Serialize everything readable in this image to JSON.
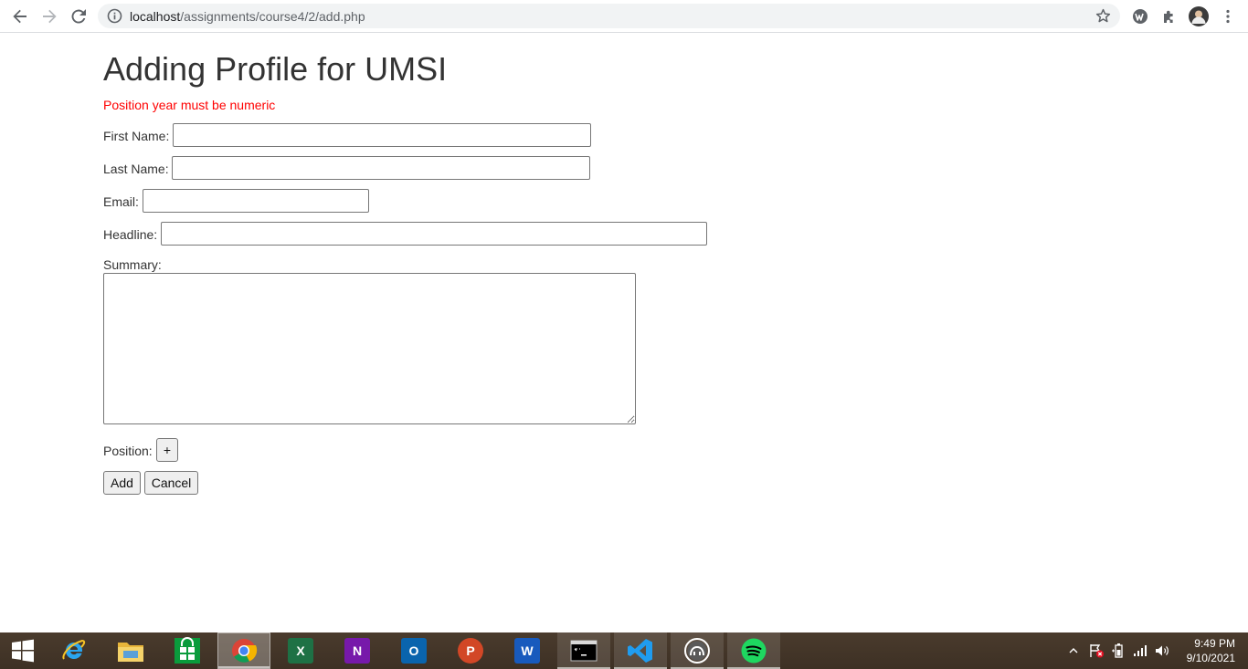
{
  "browser": {
    "url_host": "localhost",
    "url_path": "/assignments/course4/2/add.php"
  },
  "page": {
    "title": "Adding Profile for UMSI",
    "error": "Position year must be numeric",
    "fields": {
      "first_name": {
        "label": "First Name:",
        "value": ""
      },
      "last_name": {
        "label": "Last Name:",
        "value": ""
      },
      "email": {
        "label": "Email:",
        "value": ""
      },
      "headline": {
        "label": "Headline:",
        "value": ""
      },
      "summary": {
        "label": "Summary:",
        "value": ""
      }
    },
    "position": {
      "label": "Position:",
      "add_label": "+"
    },
    "buttons": {
      "add": "Add",
      "cancel": "Cancel"
    }
  },
  "taskbar": {
    "apps": [
      {
        "name": "Start",
        "icon": "windows-logo-icon"
      },
      {
        "name": "Internet Explorer",
        "icon": "internet-explorer-icon"
      },
      {
        "name": "File Explorer",
        "icon": "folder-icon"
      },
      {
        "name": "Microsoft Store",
        "icon": "store-icon"
      },
      {
        "name": "Google Chrome",
        "icon": "chrome-icon",
        "state": "active"
      },
      {
        "name": "Excel",
        "icon": "excel-icon",
        "letter": "X",
        "color": "#1e7145"
      },
      {
        "name": "OneNote",
        "icon": "onenote-icon",
        "letter": "N",
        "color": "#7719aa"
      },
      {
        "name": "Outlook",
        "icon": "outlook-icon",
        "letter": "O",
        "color": "#0a64ad"
      },
      {
        "name": "PowerPoint",
        "icon": "powerpoint-icon",
        "letter": "P",
        "color": "#d24726"
      },
      {
        "name": "Word",
        "icon": "word-icon",
        "letter": "W",
        "color": "#185abd"
      },
      {
        "name": "Command Prompt",
        "icon": "terminal-icon",
        "state": "open"
      },
      {
        "name": "Visual Studio Code",
        "icon": "vscode-icon",
        "state": "open"
      },
      {
        "name": "Mendeley",
        "icon": "mendeley-icon",
        "state": "open"
      },
      {
        "name": "Spotify",
        "icon": "spotify-icon",
        "state": "open"
      }
    ],
    "time": "9:49 PM",
    "date": "9/10/2021"
  }
}
